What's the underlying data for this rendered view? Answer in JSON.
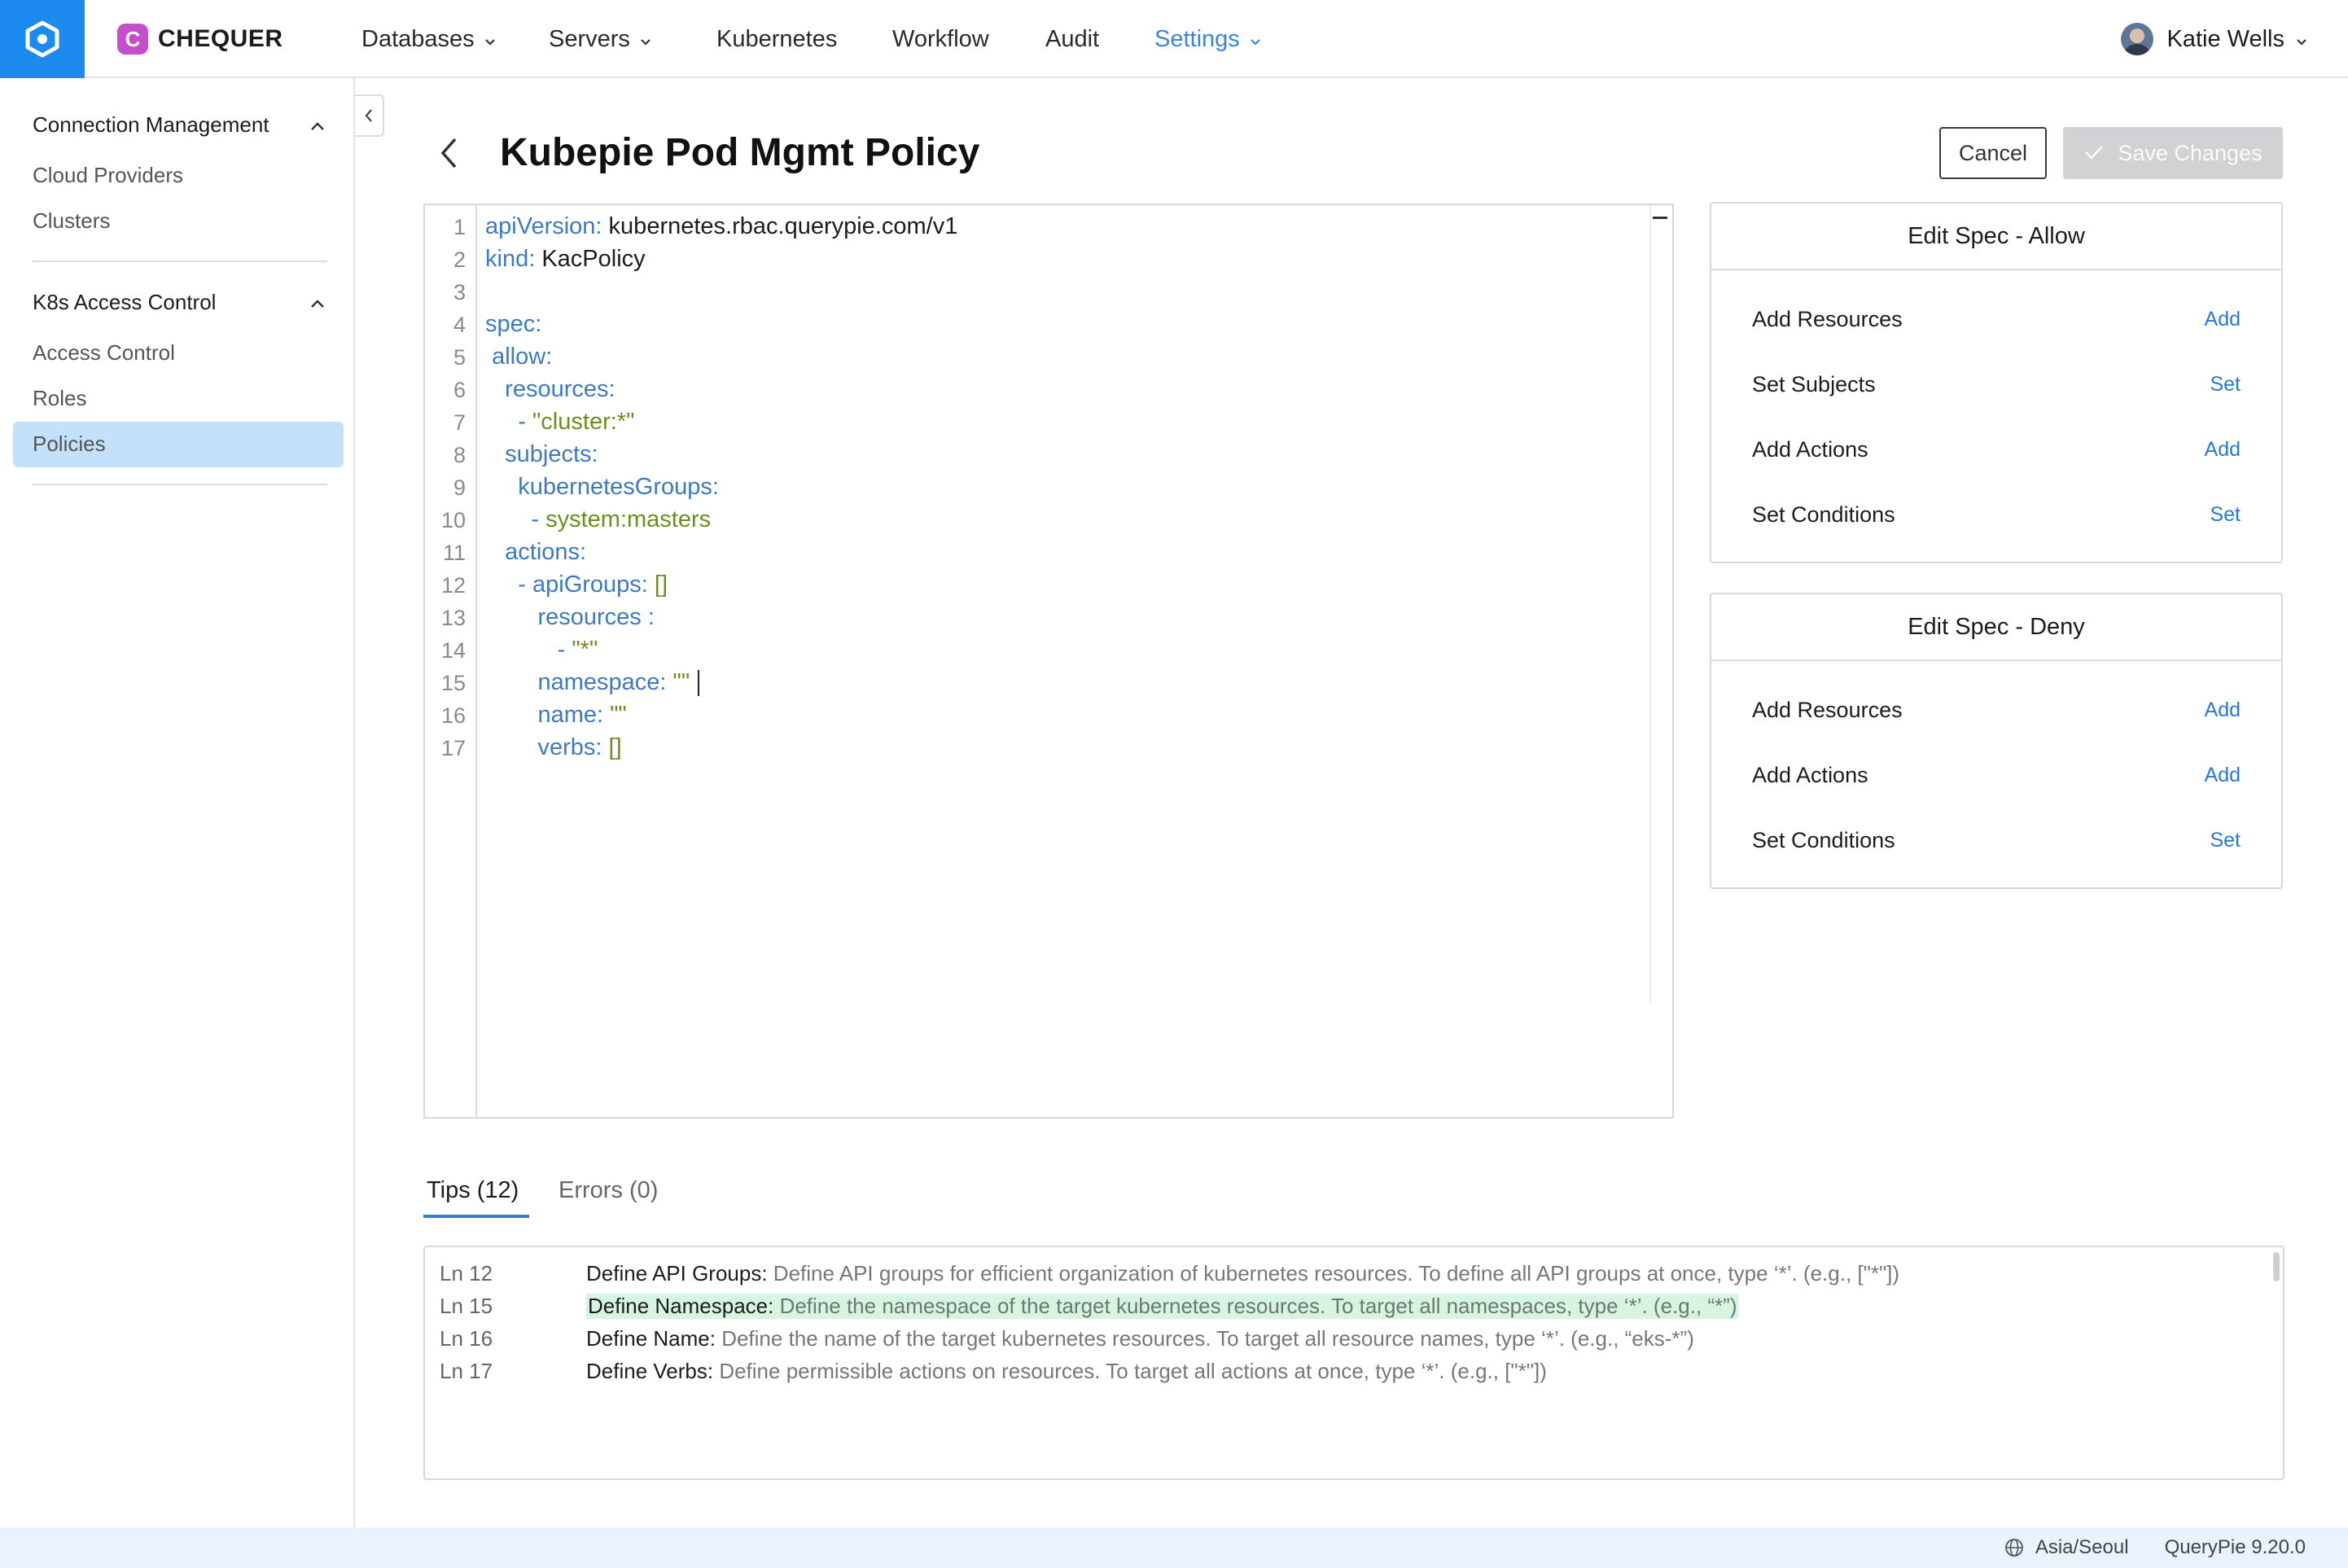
{
  "brand": {
    "name": "CHEQUER",
    "mark": "C"
  },
  "nav": {
    "databases": "Databases",
    "servers": "Servers",
    "kubernetes": "Kubernetes",
    "workflow": "Workflow",
    "audit": "Audit",
    "settings": "Settings"
  },
  "user": {
    "name": "Katie Wells"
  },
  "sidebar": {
    "section1": {
      "title": "Connection Management",
      "items": [
        "Cloud Providers",
        "Clusters"
      ]
    },
    "section2": {
      "title": "K8s Access Control",
      "items": [
        "Access Control",
        "Roles",
        "Policies"
      ],
      "active": "Policies"
    }
  },
  "header": {
    "title": "Kubepie Pod Mgmt Policy",
    "cancel_label": "Cancel",
    "save_label": "Save Changes"
  },
  "editor": {
    "lines": [
      {
        "n": "1",
        "indent": "",
        "key": "apiVersion:",
        "val": " kubernetes.rbac.querypie.com/v1",
        "val_type": "plain"
      },
      {
        "n": "2",
        "indent": "",
        "key": "kind:",
        "val": " KacPolicy",
        "val_type": "plain"
      },
      {
        "n": "3",
        "indent": "",
        "key": "",
        "val": "",
        "val_type": "plain"
      },
      {
        "n": "4",
        "indent": "",
        "key": "spec:",
        "val": "",
        "val_type": "plain"
      },
      {
        "n": "5",
        "indent": " ",
        "key": "allow:",
        "val": "",
        "val_type": "plain"
      },
      {
        "n": "6",
        "indent": "   ",
        "key": "resources:",
        "val": "",
        "val_type": "plain"
      },
      {
        "n": "7",
        "indent": "     ",
        "key": "- ",
        "val": "\"cluster:*\"",
        "val_type": "string"
      },
      {
        "n": "8",
        "indent": "   ",
        "key": "subjects:",
        "val": "",
        "val_type": "plain"
      },
      {
        "n": "9",
        "indent": "     ",
        "key": "kubernetesGroups:",
        "val": "",
        "val_type": "plain"
      },
      {
        "n": "10",
        "indent": "       ",
        "key": "- ",
        "val": "system:masters",
        "val_type": "string"
      },
      {
        "n": "11",
        "indent": "   ",
        "key": "actions:",
        "val": "",
        "val_type": "plain"
      },
      {
        "n": "12",
        "indent": "     ",
        "key": "- apiGroups:",
        "val": " []",
        "val_type": "string"
      },
      {
        "n": "13",
        "indent": "        ",
        "key": "resources :",
        "val": "",
        "val_type": "plain"
      },
      {
        "n": "14",
        "indent": "           ",
        "key": "- ",
        "val": "\"*\"",
        "val_type": "string"
      },
      {
        "n": "15",
        "indent": "        ",
        "key": "namespace:",
        "val": " \"\"",
        "val_type": "string"
      },
      {
        "n": "16",
        "indent": "        ",
        "key": "name:",
        "val": " \"\"",
        "val_type": "string"
      },
      {
        "n": "17",
        "indent": "        ",
        "key": "verbs:",
        "val": " []",
        "val_type": "string"
      }
    ],
    "caret_line": "15"
  },
  "spec_allow": {
    "title": "Edit Spec - Allow",
    "rows": [
      {
        "label": "Add Resources",
        "action": "Add"
      },
      {
        "label": "Set Subjects",
        "action": "Set"
      },
      {
        "label": "Add Actions",
        "action": "Add"
      },
      {
        "label": "Set Conditions",
        "action": "Set"
      }
    ]
  },
  "spec_deny": {
    "title": "Edit Spec - Deny",
    "rows": [
      {
        "label": "Add Resources",
        "action": "Add"
      },
      {
        "label": "Add Actions",
        "action": "Add"
      },
      {
        "label": "Set Conditions",
        "action": "Set"
      }
    ]
  },
  "tabs": {
    "tips": "Tips (12)",
    "errors": "Errors (0)"
  },
  "tips": [
    {
      "line": "Ln 12",
      "title": "Define API Groups:",
      "text": " Define API groups for efficient organization of kubernetes resources. To define all API groups at once, type ‘*’. (e.g., [\"*\"])",
      "highlight": false
    },
    {
      "line": "Ln 15",
      "title": "Define Namespace:",
      "text": " Define the namespace of the target kubernetes resources. To target all namespaces, type ‘*’. (e.g., “*”)",
      "highlight": true
    },
    {
      "line": "Ln 16",
      "title": "Define Name:",
      "text": " Define the name of the target kubernetes resources. To target all resource names, type ‘*’. (e.g., “eks-*”)",
      "highlight": false
    },
    {
      "line": "Ln 17",
      "title": "Define Verbs:",
      "text": " Define permissible actions on resources. To target all actions at once, type ‘*’. (e.g., [\"*\"])",
      "highlight": false
    }
  ],
  "footer": {
    "timezone": "Asia/Seoul",
    "version": "QueryPie 9.20.0"
  },
  "colors": {
    "brand_blue": "#1d8af0",
    "accent_blue": "#3b84e0",
    "active_bg": "#c4e1fb",
    "yaml_key": "#3d7ac0",
    "yaml_string": "#6c8f1b",
    "tip_highlight": "#d7f3e2"
  }
}
